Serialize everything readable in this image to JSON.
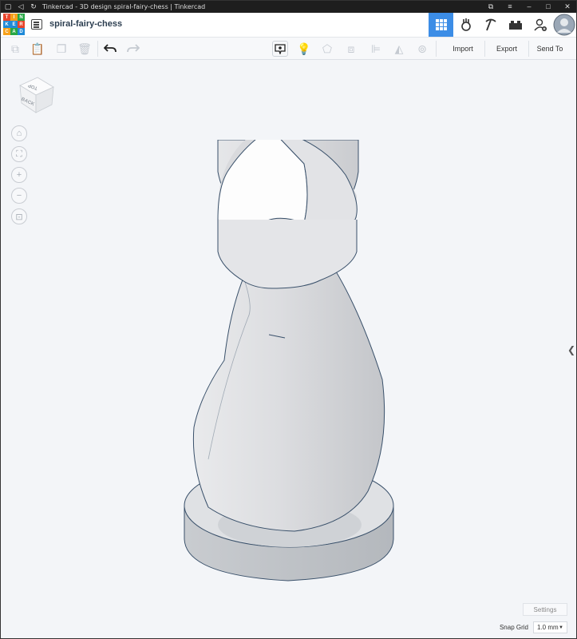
{
  "window": {
    "title": "Tinkercad - 3D design spiral-fairy-chess | Tinkercad"
  },
  "app": {
    "logo_letters": [
      "TIN",
      "KER",
      "CAD"
    ],
    "logo_colors": [
      "#e8452c",
      "#f7a11a",
      "#28a745",
      "#1f8ad8",
      "#1f8ad8",
      "#e8452c",
      "#f7a11a",
      "#28a745",
      "#1f8ad8"
    ],
    "design_title": "spiral-fairy-chess",
    "accent_color": "#3c8de6",
    "views": [
      "3d-design-view",
      "circuits-view",
      "codeblocks-view",
      "bricks-view"
    ],
    "active_view": "3d-design-view"
  },
  "toolbar": {
    "import_label": "Import",
    "export_label": "Export",
    "send_to_label": "Send To"
  },
  "viewcube": {
    "top_label": "TOP",
    "back_label": "BACK"
  },
  "workplane": {
    "settings_label": "Settings",
    "snap_grid_label": "Snap Grid",
    "snap_grid_value": "1.0 mm"
  }
}
